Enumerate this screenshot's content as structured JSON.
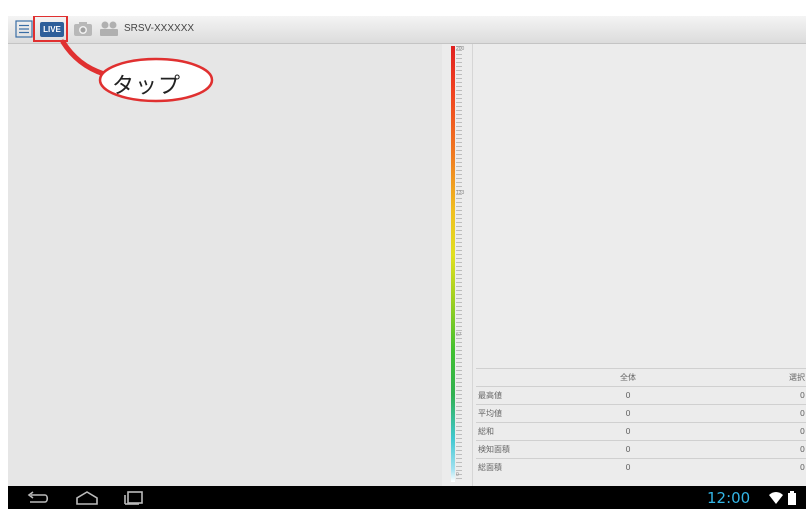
{
  "topbar": {
    "menu_icon": "menu-icon",
    "live_label": "LIVE",
    "camera_icon": "camera-icon",
    "video_icon": "video-icon",
    "device_name": "SRSV-XXXXXX"
  },
  "callout": {
    "text": "タップ"
  },
  "scale": {
    "labels": [
      "200",
      "133",
      "67",
      "0"
    ]
  },
  "stats": {
    "headers": [
      "",
      "全体",
      "選択"
    ],
    "rows": [
      {
        "label": "最高値",
        "all": "0",
        "selected": "0"
      },
      {
        "label": "平均値",
        "all": "0",
        "selected": "0"
      },
      {
        "label": "総和",
        "all": "0",
        "selected": "0"
      },
      {
        "label": "検知面積",
        "all": "0",
        "selected": "0"
      },
      {
        "label": "総面積",
        "all": "0",
        "selected": "0"
      }
    ]
  },
  "system_bar": {
    "back_icon": "back-icon",
    "home_icon": "home-icon",
    "recents_icon": "recent-apps-icon",
    "clock": "12:00",
    "wifi_icon": "wifi-icon",
    "battery_icon": "battery-icon"
  },
  "colors": {
    "highlight": "#e03030",
    "live_badge": "#2d5f9a",
    "clock": "#33b5e5"
  }
}
